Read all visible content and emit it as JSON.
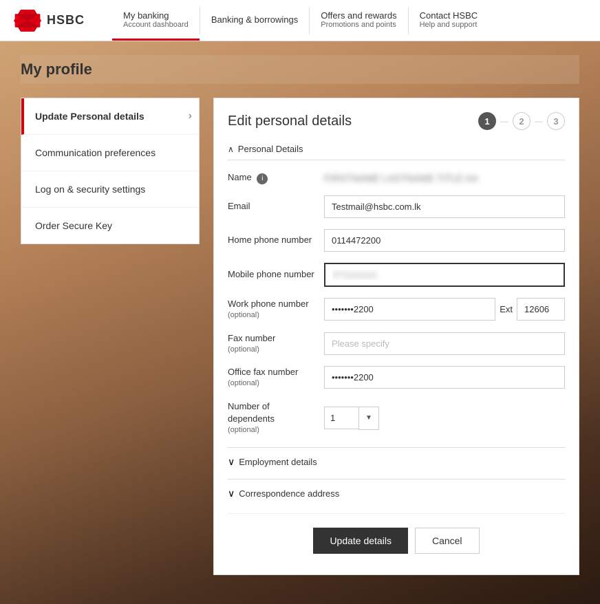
{
  "header": {
    "logo_text": "HSBC",
    "nav": [
      {
        "label": "My banking",
        "sub": "Account dashboard",
        "active": true
      },
      {
        "label": "Banking & borrowings",
        "sub": "",
        "active": false
      },
      {
        "label": "Offers and rewards",
        "sub": "Promotions and points",
        "active": false
      },
      {
        "label": "Contact HSBC",
        "sub": "Help and support",
        "active": false
      }
    ]
  },
  "page": {
    "title": "My profile"
  },
  "sidebar": {
    "items": [
      {
        "label": "Update Personal details",
        "active": true
      },
      {
        "label": "Communication preferences",
        "active": false
      },
      {
        "label": "Log on & security settings",
        "active": false
      },
      {
        "label": "Order Secure Key",
        "active": false
      }
    ]
  },
  "main": {
    "panel_title": "Edit personal details",
    "steps": [
      "1",
      "2",
      "3"
    ],
    "sections": {
      "personal_details": {
        "label": "Personal Details",
        "fields": {
          "name_label": "Name",
          "name_value": "REDACTED NAME",
          "email_label": "Email",
          "email_value": "Testmail@hsbc.com.lk",
          "home_phone_label": "Home phone number",
          "home_phone_value": "0114472200",
          "mobile_phone_label": "Mobile phone number",
          "mobile_phone_value": "0711111111",
          "work_phone_label": "Work phone number",
          "work_phone_optional": "(optional)",
          "work_phone_value": "•••••••2200",
          "ext_label": "Ext",
          "ext_value": "12606",
          "fax_label": "Fax number",
          "fax_optional": "(optional)",
          "fax_placeholder": "Please specify",
          "office_fax_label": "Office fax number",
          "office_fax_optional": "(optional)",
          "office_fax_value": "•••••••2200",
          "dependents_label": "Number of dependents",
          "dependents_optional": "(optional)",
          "dependents_value": "1"
        }
      },
      "employment_details": {
        "label": "Employment details"
      },
      "correspondence_address": {
        "label": "Correspondence address"
      }
    },
    "buttons": {
      "update": "Update details",
      "cancel": "Cancel"
    }
  }
}
